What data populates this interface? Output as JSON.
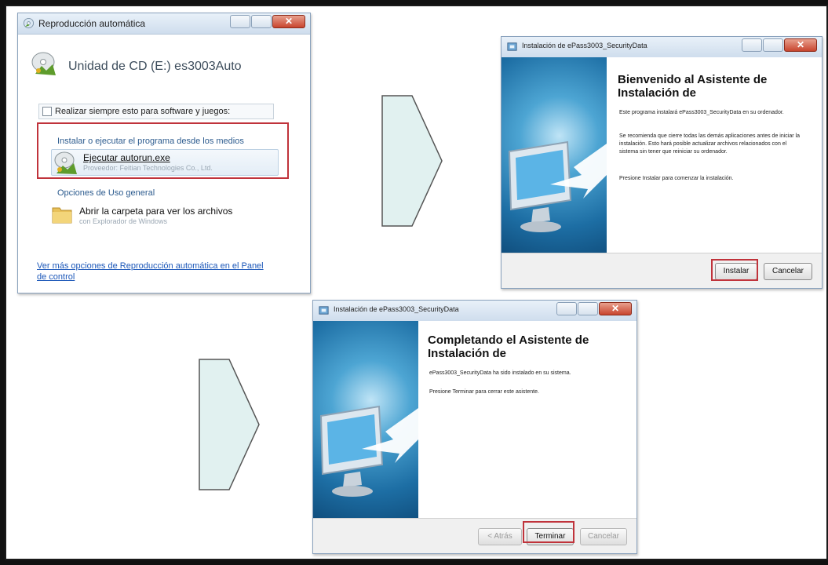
{
  "autoplay": {
    "title": "Reproducción automática",
    "drive_label": "Unidad de CD (E:) es3003Auto",
    "always_do_label": "Realizar siempre esto para software y juegos:",
    "install_section_label": "Instalar o ejecutar el programa desde los medios",
    "run_label": "Ejecutar autorun.exe",
    "run_publisher": "Proveedor: Feitian Technologies Co., Ltd.",
    "general_section_label": "Opciones de Uso general",
    "open_folder_label": "Abrir la carpeta para ver los archivos",
    "open_folder_sub": "con Explorador de Windows",
    "more_options_link": "Ver más opciones de Reproducción automática en el Panel de control"
  },
  "setup_welcome": {
    "title": "Instalación de ePass3003_SecurityData",
    "heading_line1": "Bienvenido al Asistente de",
    "heading_line2": "Instalación de",
    "para1": "Este programa instalará ePass3003_SecurityData en su ordenador.",
    "para2": "Se recomienda que cierre todas las demás aplicaciones antes de iniciar la instalación. Esto hará posible actualizar archivos relacionados con el sistema sin tener que reiniciar su ordenador.",
    "para3": "Presione Instalar para comenzar la instalación.",
    "install_button": "Instalar",
    "cancel_button": "Cancelar"
  },
  "setup_finish": {
    "title": "Instalación de ePass3003_SecurityData",
    "heading_line1": "Completando el Asistente de",
    "heading_line2": "Instalación de",
    "para1": "ePass3003_SecurityData ha sido instalado en su sistema.",
    "para2": "Presione Terminar para cerrar este asistente.",
    "back_button": "< Atrás",
    "finish_button": "Terminar",
    "cancel_button": "Cancelar"
  },
  "colors": {
    "highlight_red": "#c0333b",
    "arrow_fill": "#e1f1f0",
    "link_blue": "#1a56b8"
  }
}
